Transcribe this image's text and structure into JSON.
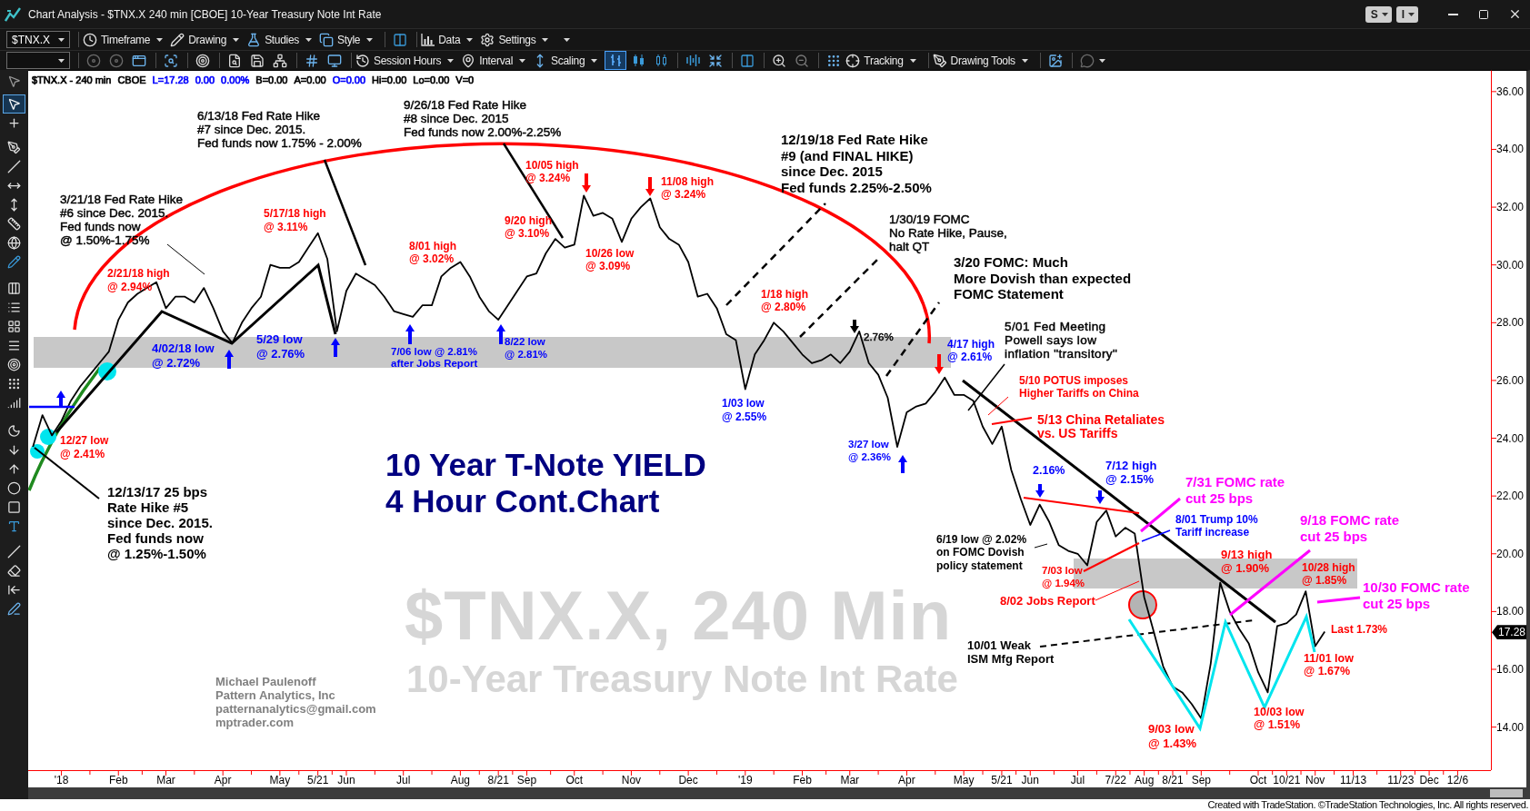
{
  "window": {
    "title": "Chart Analysis - $TNX.X 240 min [CBOE] 10-Year Treasury Note Int Rate",
    "title_buttons": [
      "S",
      "I"
    ]
  },
  "main_toolbar": {
    "symbol": "$TNX.X",
    "menus": [
      "Timeframe",
      "Drawing",
      "Studies",
      "Style",
      "Data",
      "Settings"
    ]
  },
  "chart_toolbar": {
    "view_menus": [
      "Session Hours",
      "Interval",
      "Scaling"
    ],
    "chart_styles": [
      {
        "selected": true
      },
      {
        "selected": false
      },
      {
        "selected": false
      }
    ],
    "tool_menus": [
      "Tracking",
      "Drawing Tools"
    ]
  },
  "drawing_toolbar": {
    "tools": [
      {
        "selected": false
      },
      {
        "selected": true
      },
      {
        "selected": false
      },
      {
        "selected": false
      },
      {
        "selected": false
      },
      {
        "selected": false
      },
      {
        "selected": false
      },
      {
        "selected": false
      },
      {
        "selected": false
      },
      {
        "selected": false
      },
      {
        "selected": false
      },
      {
        "selected": false
      },
      {
        "selected": false
      },
      {
        "selected": false
      },
      {
        "selected": false
      },
      {
        "selected": false
      },
      {
        "selected": false
      },
      {
        "selected": false
      },
      {
        "selected": false
      },
      {
        "selected": false
      },
      {
        "selected": false
      },
      {
        "selected": false
      },
      {
        "selected": false
      },
      {
        "selected": false
      },
      {
        "selected": false
      },
      {
        "selected": false
      },
      {
        "selected": false
      }
    ]
  },
  "chart": {
    "legend": [
      {
        "text": "CBOE",
        "color": "#000000"
      },
      {
        "text": "L=17.28",
        "color": "#0000ff"
      },
      {
        "text": "0.00",
        "color": "#0000ff"
      },
      {
        "text": "0.00%",
        "color": "#0000ff"
      },
      {
        "text": "B=0.00",
        "color": "#000000"
      },
      {
        "text": "A=0.00",
        "color": "#000000"
      },
      {
        "text": "O=0.00",
        "color": "#0000ff"
      },
      {
        "text": "Hi=0.00",
        "color": "#000000"
      },
      {
        "text": "Lo=0.00",
        "color": "#000000"
      },
      {
        "text": "V=0",
        "color": "#000000"
      }
    ],
    "watermark": {
      "symbol": "$TNX.X, 240 Min",
      "description": "10-Year Treasury Note Int Rate"
    },
    "last_price": "17.28",
    "notes": [
      {
        "text": "6/13/18 Fed Rate Hike\n#7 since Dec. 2015.\nFed funds now 1.75% - 2.00%",
        "color": "#000000"
      },
      {
        "text": "9/26/18 Fed Rate Hike\n#8 since Dec. 2015\nFed funds now 2.00%-2.25%",
        "color": "#000000"
      },
      {
        "text": "10/05 high\n@ 3.24%",
        "color": "#ff0000"
      },
      {
        "text": "11/08 high\n@ 3.24%",
        "color": "#ff0000"
      },
      {
        "text": "12/19/18 Fed Rate Hike\n#9 (and FINAL HIKE)\nsince Dec. 2015\nFed funds 2.25%-2.50%",
        "color": "#000000"
      },
      {
        "text": "3/21/18 Fed Rate Hike\n#6 since Dec. 2015.\nFed funds now\n@ 1.50%-1.75%",
        "color": "#000000"
      },
      {
        "text": "5/17/18 high\n@ 3.11%",
        "color": "#ff0000"
      },
      {
        "text": "9/20 high\n@ 3.10%",
        "color": "#ff0000"
      },
      {
        "text": "8/01 high\n@ 3.02%",
        "color": "#ff0000"
      },
      {
        "text": "1/30/19 FOMC\nNo Rate Hike, Pause,\nhalt QT",
        "color": "#000000"
      },
      {
        "text": "10/26 low\n@ 3.09%",
        "color": "#ff0000"
      },
      {
        "text": "2/21/18 high\n@ 2.94%",
        "color": "#ff0000"
      },
      {
        "text": "1/18 high\n@ 2.80%",
        "color": "#ff0000"
      },
      {
        "text": "3/20 FOMC: Much\nMore Dovish than expected\nFOMC Statement",
        "color": "#000000"
      },
      {
        "text": "4/02/18 low\n@ 2.72%",
        "color": "#0000ff"
      },
      {
        "text": "5/29 low\n@ 2.76%",
        "color": "#0000ff"
      },
      {
        "text": "7/06 low @ 2.81%\nafter Jobs Report",
        "color": "#0000ff"
      },
      {
        "text": "8/22 low\n@ 2.81%",
        "color": "#0000ff"
      },
      {
        "text": "2.76%",
        "color": "#000000"
      },
      {
        "text": "4/17 high\n@ 2.61%",
        "color": "#0000ff"
      },
      {
        "text": "5/01 Fed Meeting\nPowell says low\ninflation \"transitory\"",
        "color": "#000000"
      },
      {
        "text": "5/10 POTUS imposes\nHigher Tariffs on China",
        "color": "#ff0000"
      },
      {
        "text": "1/03 low\n@ 2.55%",
        "color": "#0000ff"
      },
      {
        "text": "5/13 China Retaliates\nvs. US Tariffs",
        "color": "#ff0000"
      },
      {
        "text": "12/27 low\n@ 2.41%",
        "color": "#ff0000"
      },
      {
        "text": "3/27 low\n@ 2.36%",
        "color": "#0000ff"
      },
      {
        "text": "2.16%",
        "color": "#0000ff"
      },
      {
        "text": "7/12 high\n@ 2.15%",
        "color": "#0000ff"
      },
      {
        "text": "12/13/17 25 bps\nRate Hike #5\nsince Dec. 2015.\nFed funds now\n@ 1.25%-1.50%",
        "color": "#000000"
      },
      {
        "text": "7/31 FOMC rate\ncut 25 bps",
        "color": "#ff00ff"
      },
      {
        "text": "8/01 Trump 10%\nTariff increase",
        "color": "#0000ff"
      },
      {
        "text": "9/18 FOMC rate\ncut 25 bps",
        "color": "#ff00ff"
      },
      {
        "text": "6/19 low @ 2.02%\non FOMC Dovish\npolicy statement",
        "color": "#000000"
      },
      {
        "text": "7/03 low\n@ 1.94%",
        "color": "#ff0000"
      },
      {
        "text": "9/13 high\n@ 1.90%",
        "color": "#ff0000"
      },
      {
        "text": "10/28 high\n@ 1.85%",
        "color": "#ff0000"
      },
      {
        "text": "8/02 Jobs Report",
        "color": "#ff0000"
      },
      {
        "text": "10/30 FOMC rate\ncut 25 bps",
        "color": "#ff00ff"
      },
      {
        "text": "Last 1.73%",
        "color": "#ff0000"
      },
      {
        "text": "10/01 Weak\nISM Mfg Report",
        "color": "#000000"
      },
      {
        "text": "11/01 low\n@ 1.67%",
        "color": "#ff0000"
      },
      {
        "text": "Michael Paulenoff\nPattern Analytics, Inc\npatternanalytics@gmail.com\nmptrader.com",
        "color": "#808080"
      },
      {
        "text": "10/03 low\n@ 1.51%",
        "color": "#ff0000"
      },
      {
        "text": "9/03 low\n@ 1.43%",
        "color": "#ff0000"
      }
    ],
    "chart_data": {
      "type": "line",
      "title": "10 Year T-Note YIELD\n4 Hour Cont.Chart",
      "categories": [
        null,
        null,
        null,
        "'18",
        null,
        null,
        null,
        null,
        null,
        "Feb",
        null,
        null,
        null,
        null,
        "Mar",
        null,
        null,
        null,
        null,
        null,
        "Apr",
        null,
        null,
        null,
        null,
        null,
        "May",
        null,
        null,
        null,
        "5/21",
        null,
        null,
        "Jun",
        null,
        null,
        null,
        null,
        null,
        "Jul",
        null,
        null,
        null,
        null,
        null,
        "Aug",
        null,
        null,
        null,
        "8/21",
        null,
        null,
        "Sep",
        null,
        null,
        null,
        null,
        "Oct",
        null,
        null,
        null,
        null,
        null,
        "Nov",
        null,
        null,
        null,
        null,
        null,
        "Dec",
        null,
        null,
        null,
        null,
        null,
        "'19",
        null,
        null,
        null,
        null,
        null,
        "Feb",
        null,
        null,
        null,
        null,
        "Mar",
        null,
        null,
        null,
        null,
        null,
        "Apr",
        null,
        null,
        null,
        null,
        null,
        "May",
        null,
        null,
        null,
        "5/21",
        null,
        null,
        "Jun",
        null,
        null,
        null,
        null,
        "Jul",
        null,
        null,
        null,
        "7/22",
        null,
        null,
        "Aug",
        null,
        null,
        "8/21",
        null,
        null,
        "Sep",
        null,
        null,
        null,
        null,
        null,
        "Oct",
        null,
        null,
        "10/21",
        null,
        null,
        "Nov",
        null,
        null,
        null,
        "11/13",
        null,
        null,
        null,
        null,
        "11/23",
        null,
        null,
        "Dec",
        null,
        null,
        "12/6",
        null,
        null,
        null
      ],
      "series": [
        {
          "name": "$TNX.X - 240 min",
          "color": "#000000",
          "values": [
            23.7,
            24.8,
            24.1,
            24.6,
            25.3,
            25.8,
            26.2,
            26.6,
            27.0,
            28.1,
            28.7,
            29.0,
            29.2,
            29.4,
            28.5,
            28.9,
            28.9,
            28.7,
            29.2,
            28.5,
            27.7,
            27.3,
            28.0,
            28.5,
            28.9,
            30.0,
            29.9,
            29.9,
            30.1,
            30.6,
            31.1,
            30.2,
            27.7,
            29.1,
            29.7,
            29.5,
            29.3,
            28.9,
            28.4,
            28.3,
            28.2,
            28.6,
            28.6,
            29.6,
            29.9,
            30.1,
            29.6,
            28.9,
            28.4,
            28.1,
            28.6,
            29.1,
            29.6,
            29.7,
            30.4,
            30.9,
            30.6,
            30.7,
            32.4,
            31.7,
            31.8,
            31.6,
            30.8,
            31.6,
            32.0,
            32.3,
            31.3,
            30.9,
            30.7,
            30.1,
            28.9,
            29.0,
            28.5,
            27.6,
            27.4,
            25.7,
            26.9,
            27.4,
            28.0,
            27.7,
            27.3,
            26.9,
            26.6,
            26.7,
            26.9,
            26.6,
            27.0,
            27.7,
            26.6,
            26.2,
            25.4,
            23.7,
            24.9,
            25.1,
            25.2,
            25.6,
            26.1,
            25.5,
            25.5,
            25.3,
            24.4,
            23.8,
            24.4,
            22.9,
            21.9,
            21.0,
            21.7,
            21.1,
            20.3,
            20.1,
            20.0,
            19.6,
            21.1,
            21.5,
            20.6,
            20.9,
            20.7,
            18.5,
            17.3,
            16.1,
            15.4,
            15.2,
            14.8,
            14.3,
            16.2,
            19.0,
            18.0,
            17.4,
            16.9,
            15.9,
            15.2,
            17.5,
            17.6,
            17.9,
            18.7,
            16.8,
            17.3,
            null,
            null,
            null,
            null,
            null,
            null,
            null,
            null,
            null,
            null,
            null,
            null,
            null,
            null,
            null,
            null,
            null
          ]
        }
      ],
      "ylim": [
        12.51,
        36.75
      ],
      "yticks": [
        {
          "value": 36,
          "label": "36.00"
        },
        {
          "value": 34,
          "label": "34.00"
        },
        {
          "value": 32,
          "label": "32.00"
        },
        {
          "value": 30,
          "label": "30.00"
        },
        {
          "value": 28,
          "label": "28.00"
        },
        {
          "value": 26,
          "label": "26.00"
        },
        {
          "value": 24,
          "label": "24.00"
        },
        {
          "value": 22,
          "label": "22.00"
        },
        {
          "value": 20,
          "label": "20.00"
        },
        {
          "value": 18,
          "label": "18.00"
        },
        {
          "value": 16,
          "label": "16.00"
        },
        {
          "value": 14,
          "label": "14.00"
        }
      ]
    }
  },
  "status_bar": {
    "text": "Created with TradeStation. ©TradeStation Technologies, Inc. All rights reserved."
  }
}
